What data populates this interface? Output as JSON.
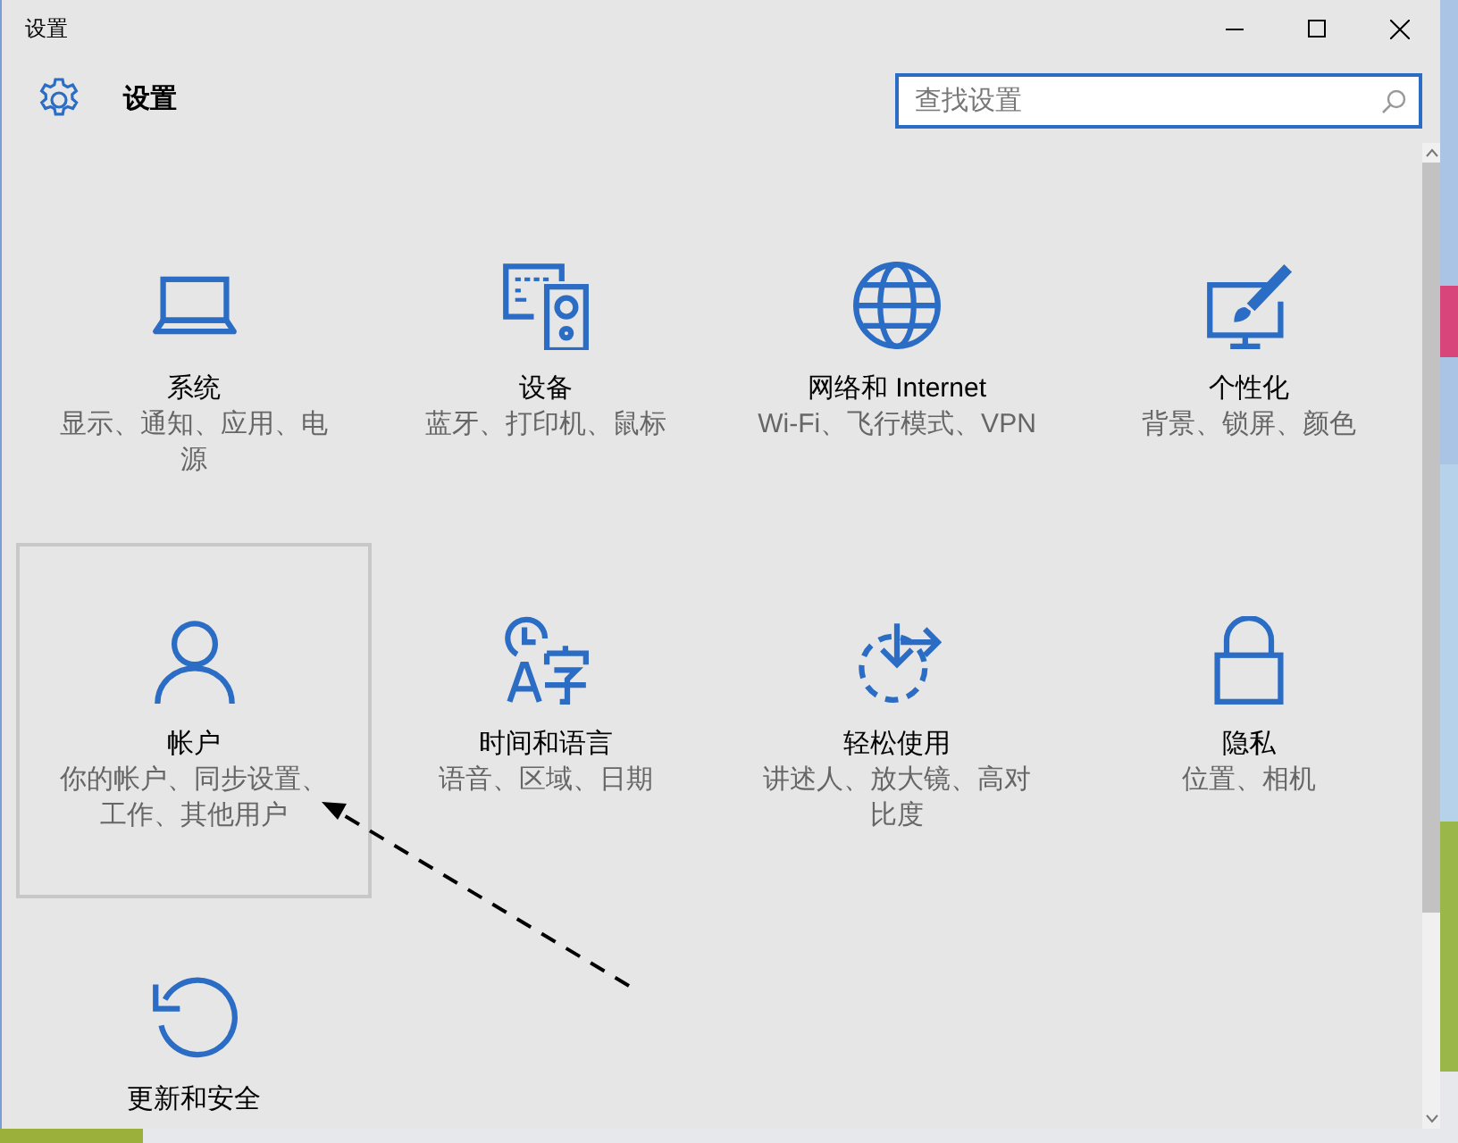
{
  "window": {
    "title": "设置"
  },
  "header": {
    "title": "设置"
  },
  "search": {
    "placeholder": "查找设置"
  },
  "tiles": [
    {
      "kind": "laptop",
      "title": "系统",
      "description": "显示、通知、应用、电源",
      "selected": false
    },
    {
      "kind": "devices",
      "title": "设备",
      "description": "蓝牙、打印机、鼠标",
      "selected": false
    },
    {
      "kind": "globe",
      "title": "网络和 Internet",
      "description": "Wi-Fi、飞行模式、VPN",
      "selected": false
    },
    {
      "kind": "paint",
      "title": "个性化",
      "description": "背景、锁屏、颜色",
      "selected": false
    },
    {
      "kind": "person",
      "title": "帐户",
      "description": "你的帐户、同步设置、工作、其他用户",
      "selected": true
    },
    {
      "kind": "time",
      "title": "时间和语言",
      "description": "语音、区域、日期",
      "selected": false
    },
    {
      "kind": "ease",
      "title": "轻松使用",
      "description": "讲述人、放大镜、高对比度",
      "selected": false
    },
    {
      "kind": "lock",
      "title": "隐私",
      "description": "位置、相机",
      "selected": false
    },
    {
      "kind": "update",
      "title": "更新和安全",
      "selected": false
    }
  ]
}
